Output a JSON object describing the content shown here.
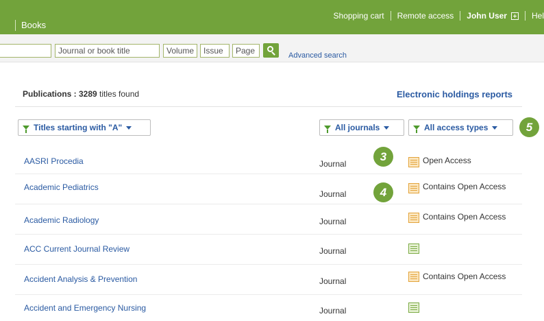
{
  "topbar": {
    "section_label": "Books",
    "links": {
      "shopping_cart": "Shopping cart",
      "remote_access": "Remote access",
      "user_name": "John User",
      "help": "Hel"
    }
  },
  "search": {
    "journal_placeholder": "Journal or book title",
    "volume_placeholder": "Volume",
    "issue_placeholder": "Issue",
    "page_placeholder": "Page",
    "advanced_label": "Advanced search"
  },
  "listing": {
    "count_label": "Publications : 3289",
    "count_suffix": " titles found",
    "holdings_link": "Electronic holdings reports"
  },
  "filters": {
    "titles": "Titles starting with \"A\"",
    "journals": "All journals",
    "access": "All access types"
  },
  "callouts": [
    "3",
    "4",
    "5"
  ],
  "rows": [
    {
      "title": "AASRI Procedia",
      "type": "Journal",
      "access": "Open Access",
      "icon": "open-access-icon"
    },
    {
      "title": "Academic Pediatrics",
      "type": "Journal",
      "access": "Contains Open Access",
      "icon": "partial-open-access-icon"
    },
    {
      "title": "Academic Radiology",
      "type": "Journal",
      "access": "Contains Open Access",
      "icon": "partial-open-access-icon"
    },
    {
      "title": "ACC Current Journal Review",
      "type": "Journal",
      "access": "",
      "icon": "subscribed-icon"
    },
    {
      "title": "Accident Analysis & Prevention",
      "type": "Journal",
      "access": "Contains Open Access",
      "icon": "partial-open-access-icon"
    },
    {
      "title": "Accident and Emergency Nursing",
      "type": "Journal",
      "access": "",
      "icon": "subscribed-icon"
    }
  ],
  "colors": {
    "brand_green": "#72a33b",
    "link_blue": "#2a5aa2",
    "open_access_orange": "#e3a33a",
    "subscribed_green": "#7cab45"
  }
}
